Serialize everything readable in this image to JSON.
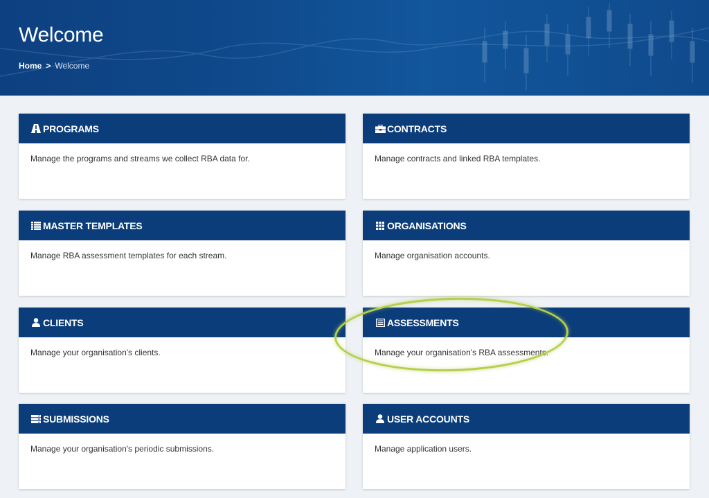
{
  "page": {
    "title": "Welcome"
  },
  "breadcrumb": {
    "home": "Home",
    "separator": ">",
    "current": "Welcome"
  },
  "colors": {
    "card_header": "#0b3d7a",
    "hero": "#0f4a8c",
    "highlight": "#b5cf4c"
  },
  "cards": [
    {
      "title": "PROGRAMS",
      "icon": "road-icon",
      "description": "Manage the programs and streams we collect RBA data for."
    },
    {
      "title": "CONTRACTS",
      "icon": "briefcase-icon",
      "description": "Manage contracts and linked RBA templates."
    },
    {
      "title": "MASTER TEMPLATES",
      "icon": "list-icon",
      "description": "Manage RBA assessment templates for each stream."
    },
    {
      "title": "ORGANISATIONS",
      "icon": "grid-icon",
      "description": "Manage organisation accounts."
    },
    {
      "title": "CLIENTS",
      "icon": "user-icon",
      "description": "Manage your organisation's clients."
    },
    {
      "title": "ASSESSMENTS",
      "icon": "document-icon",
      "description": "Manage your organisation's RBA assessments."
    },
    {
      "title": "SUBMISSIONS",
      "icon": "stack-icon",
      "description": "Manage your organisation's periodic submissions."
    },
    {
      "title": "USER ACCOUNTS",
      "icon": "user-icon",
      "description": "Manage application users."
    }
  ]
}
